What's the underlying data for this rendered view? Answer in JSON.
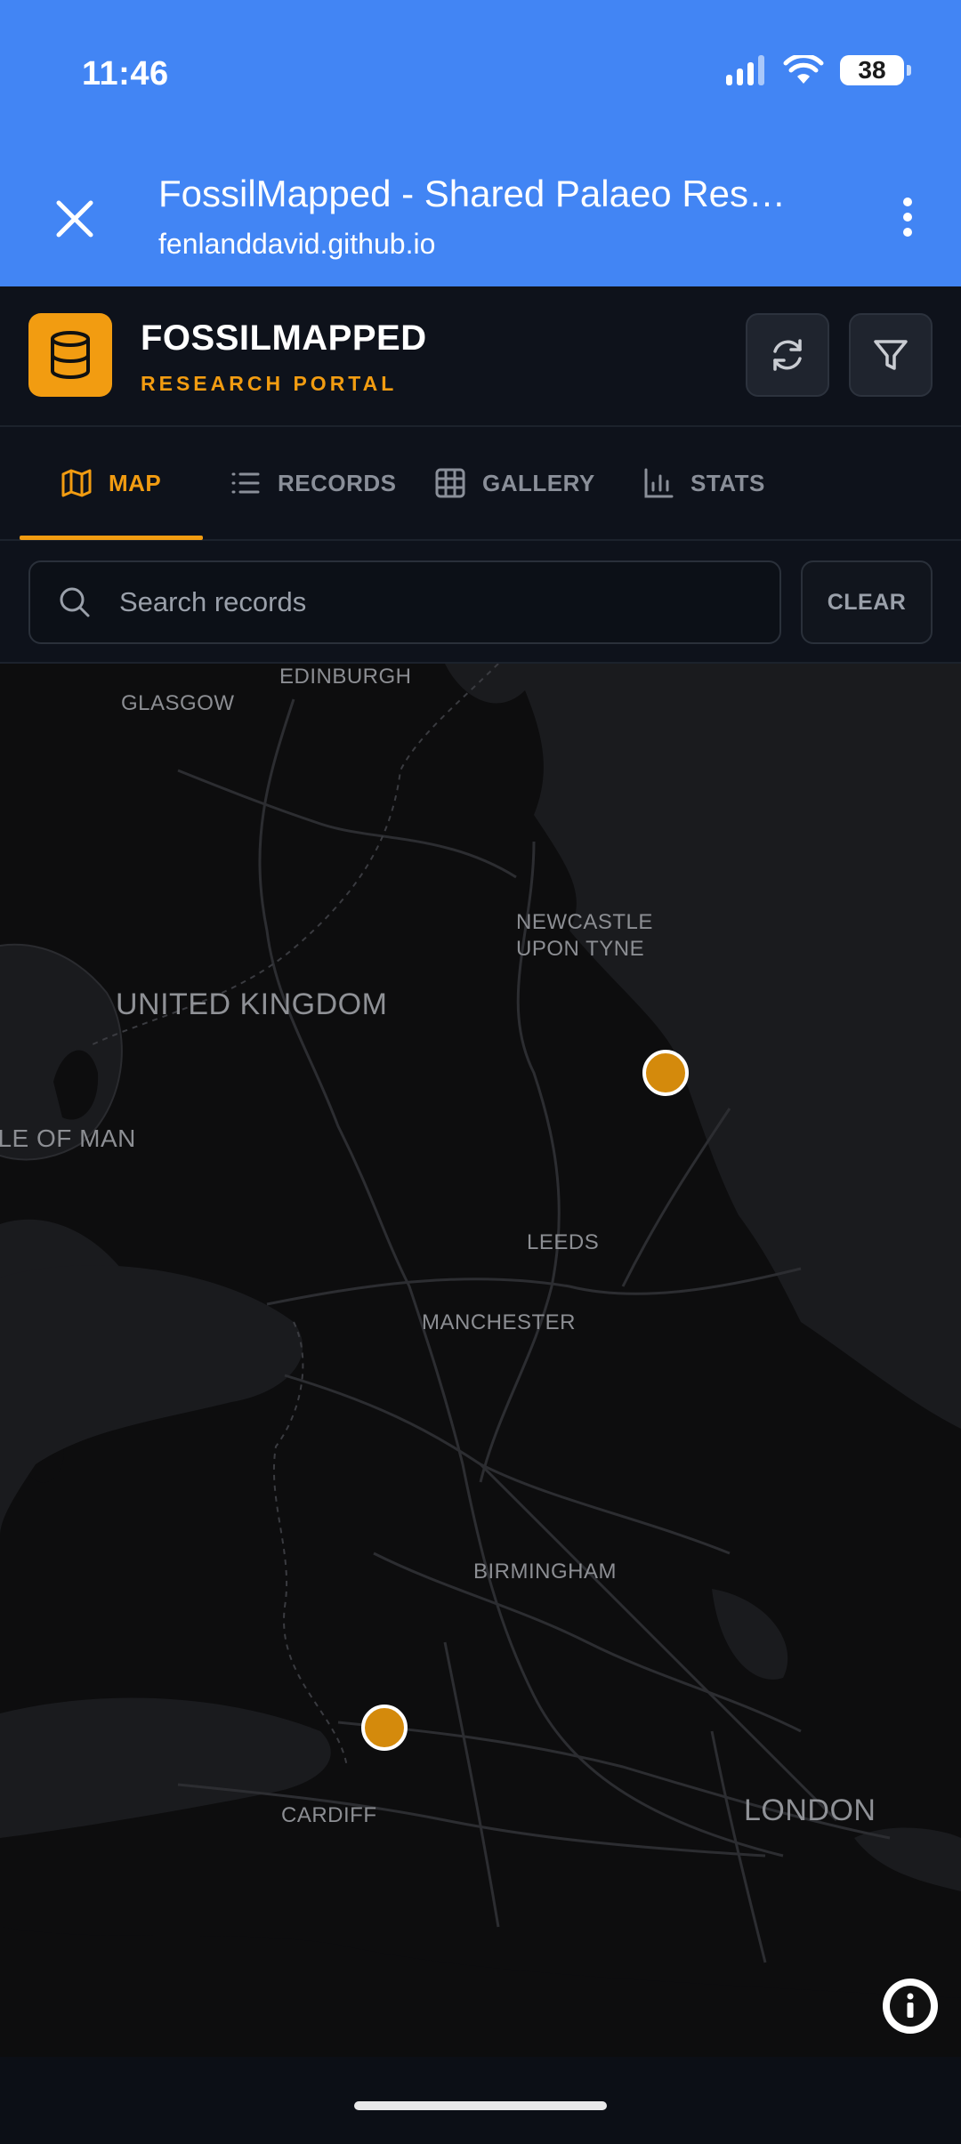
{
  "status_bar": {
    "time": "11:46",
    "battery": "38",
    "icons": [
      "signal-icon",
      "wifi-icon",
      "battery-icon"
    ]
  },
  "browser": {
    "title": "FossilMapped - Shared Palaeo Rese...",
    "url": "fenlanddavid.github.io",
    "close_icon": "close-icon",
    "menu_icon": "more-vert-icon"
  },
  "header": {
    "app_name": "FOSSILMAPPED",
    "subtitle": "RESEARCH PORTAL",
    "logo_icon": "database-icon",
    "actions": [
      "refresh-icon",
      "filter-icon"
    ]
  },
  "tabs": [
    {
      "label": "MAP",
      "icon": "map-icon",
      "active": true
    },
    {
      "label": "RECORDS",
      "icon": "list-icon",
      "active": false
    },
    {
      "label": "GALLERY",
      "icon": "grid-icon",
      "active": false
    },
    {
      "label": "STATS",
      "icon": "bar-chart-icon",
      "active": false
    }
  ],
  "search": {
    "placeholder": "Search records",
    "value": "",
    "clear_label": "CLEAR"
  },
  "map": {
    "labels": {
      "edinburgh": "EDINBURGH",
      "glasgow": "GLASGOW",
      "newcastle": "NEWCASTLE\nUPON TYNE",
      "uk": "UNITED KINGDOM",
      "isle_of_man": "ISLE OF MAN",
      "leeds": "LEEDS",
      "manchester": "MANCHESTER",
      "birmingham": "BIRMINGHAM",
      "cardiff": "CARDIFF",
      "london": "LONDON"
    },
    "marker_color": "#d48a0c",
    "marker_count": 2
  },
  "colors": {
    "accent": "#f29c11",
    "browser_bar": "#4285f4",
    "background": "#0e121b"
  }
}
